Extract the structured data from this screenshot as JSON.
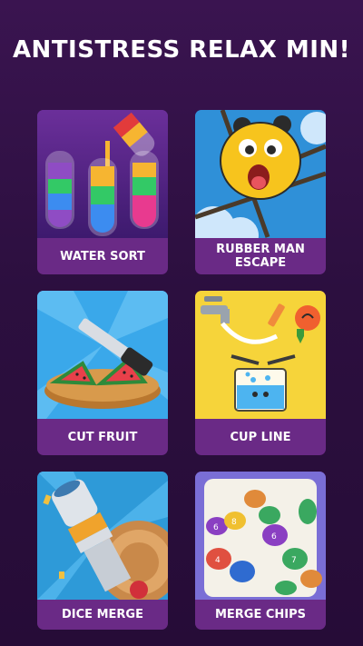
{
  "header": {
    "title": "ANTISTRESS RELAX MIN!"
  },
  "games": [
    {
      "label": "WATER SORT",
      "icon": "water-sort-tubes-icon"
    },
    {
      "label": "RUBBER MAN ESCAPE",
      "icon": "rubber-man-face-icon"
    },
    {
      "label": "CUT FRUIT",
      "icon": "knife-watermelon-icon"
    },
    {
      "label": "CUP LINE",
      "icon": "cup-line-faucet-icon"
    },
    {
      "label": "DICE MERGE",
      "icon": "knife-hit-log-icon"
    },
    {
      "label": "MERGE CHIPS",
      "icon": "stacked-chips-icon"
    }
  ],
  "colors": {
    "card": "#6a2a86",
    "background": "#2c0f3f"
  }
}
